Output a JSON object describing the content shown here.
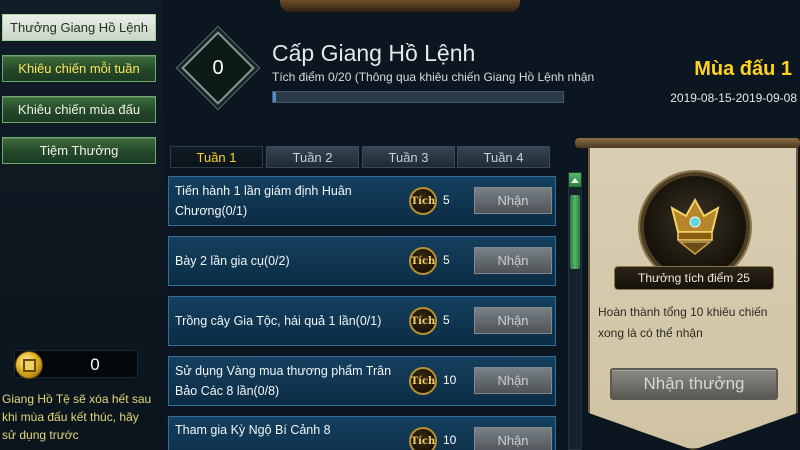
{
  "menu": {
    "items": [
      {
        "label": "Thưởng Giang Hồ Lệnh"
      },
      {
        "label": "Khiêu chiến mỗi tuần"
      },
      {
        "label": "Khiêu chiến mùa đấu"
      },
      {
        "label": "Tiệm Thưởng"
      }
    ]
  },
  "wallet": {
    "value": "0",
    "note": "Giang Hồ Tệ sẽ xóa hết sau khi mùa đấu kết thúc, hãy sử dụng trước"
  },
  "header": {
    "level": "0",
    "title": "Cấp Giang Hồ Lệnh",
    "progress_text": "Tích điểm 0/20 (Thông qua khiêu chiến Giang Hồ Lệnh nhận",
    "progress": 0,
    "season_name": "Mùa đấu 1",
    "season_dates": "2019-08-15-2019-09-08"
  },
  "tabs": [
    {
      "label": "Tuần 1"
    },
    {
      "label": "Tuần 2"
    },
    {
      "label": "Tuần 3"
    },
    {
      "label": "Tuần 4"
    }
  ],
  "tasks": [
    {
      "text": "Tiến hành 1 lần giám định Huân Chương(0/1)",
      "icon_label": "Tích",
      "points": "5",
      "button": "Nhận"
    },
    {
      "text": "Bày 2 lần gia cụ(0/2)",
      "icon_label": "Tích",
      "points": "5",
      "button": "Nhận"
    },
    {
      "text": "Trồng cây Gia Tộc, hái quả 1 lần(0/1)",
      "icon_label": "Tích",
      "points": "5",
      "button": "Nhận"
    },
    {
      "text": "Sử dụng Vàng mua thương phẩm Trân Bảo Các 8 lần(0/8)",
      "icon_label": "Tích",
      "points": "10",
      "button": "Nhận"
    },
    {
      "text": "Tham gia Kỳ Ngộ Bí Cảnh 8",
      "icon_label": "Tích",
      "points": "10",
      "button": "Nhận"
    }
  ],
  "reward": {
    "label": "Thưởng tích điểm 25",
    "description": "Hoàn thành tổng 10 khiêu chiến xong là có thể nhận",
    "button": "Nhận thưởng"
  },
  "colors": {
    "accent_yellow": "#ffd21e",
    "menu_green": "#24482a",
    "task_blue": "#14405f",
    "panel_parchment": "#d9cfb4"
  }
}
